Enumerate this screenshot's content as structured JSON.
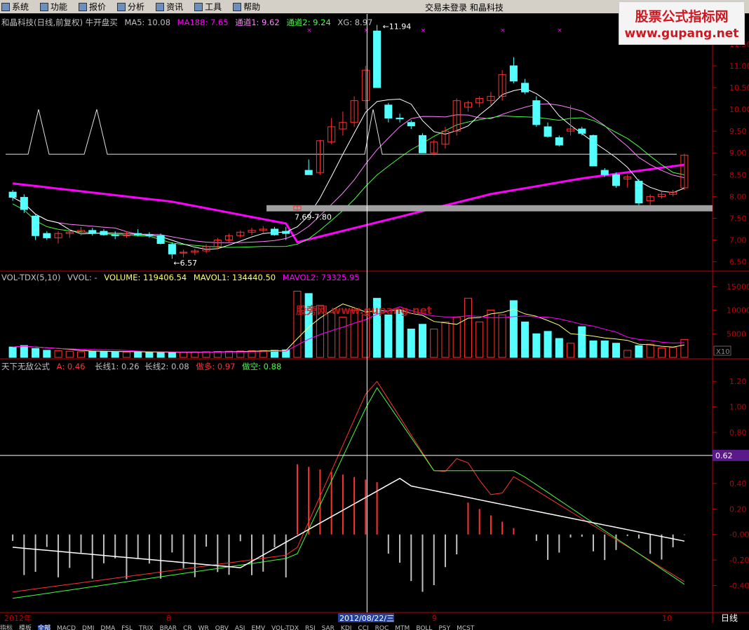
{
  "menu": {
    "items": [
      {
        "label": "系统",
        "icon": "system-icon"
      },
      {
        "label": "功能",
        "icon": "function-icon"
      },
      {
        "label": "报价",
        "icon": "quote-icon"
      },
      {
        "label": "分析",
        "icon": "analysis-icon"
      },
      {
        "label": "资讯",
        "icon": "news-icon"
      },
      {
        "label": "工具",
        "icon": "tools-icon"
      },
      {
        "label": "帮助",
        "icon": "help-icon"
      }
    ],
    "center_text": "交易未登录  和晶科技"
  },
  "watermark": {
    "line1": "股票公式指标网",
    "line2": "www.gupang.net",
    "center": "股旁网 www.gupang.net"
  },
  "colors": {
    "up": "#ff3232",
    "down": "#54ffff",
    "ma5": "#ffffff",
    "ma188": "#ff00ff",
    "ch1": "#ff80ff",
    "ch2": "#40ff40",
    "axis": "#c00000",
    "cross": "#ffffff",
    "selected": "#5a1a8a"
  },
  "price_panel": {
    "title": "和晶科技(日线,前复权) 牛开盘买",
    "ma5": "MA5: 10.08",
    "ma188": "MA188: 7.65",
    "ch1": "通道1: 9.62",
    "ch2": "通道2: 9.24",
    "xg": "XG: 8.97",
    "y_ticks": [
      "11.50",
      "11.00",
      "10.50",
      "10.00",
      "9.50",
      "9.00",
      "8.50",
      "8.00",
      "7.50",
      "7.00",
      "6.50"
    ],
    "annotations": {
      "high": "11.94",
      "low": "6.57",
      "range": "7.69-7.80"
    }
  },
  "vol_panel": {
    "title": "VOL-TDX(5,10)",
    "vvol": "VVOL: -",
    "volume": "VOLUME: 119406.54",
    "mavol1": "MAVOL1: 134440.50",
    "mavol2": "MAVOL2: 73325.95",
    "y_ticks": [
      "15000",
      "10000",
      "5000"
    ],
    "unit": "X10"
  },
  "ind_panel": {
    "title": "天下无敌公式",
    "a": "A: 0.46",
    "long1": "长线1: 0.26",
    "long2": "长线2: 0.08",
    "bull": "做多: 0.97",
    "bear": "做空: 0.88",
    "y_ticks": [
      "1.20",
      "1.00",
      "0.80",
      "0.60",
      "0.40",
      "0.20",
      "-0.00",
      "-0.20",
      "-0.40"
    ],
    "crosshair_value": "0.62"
  },
  "x_axis": {
    "labels": [
      "2012年",
      "8",
      "2012/08/22/三",
      "9",
      "10"
    ],
    "period": "日线"
  },
  "bottom_tabs": [
    "指标",
    "模板",
    "全部",
    "MACD",
    "DMI",
    "DMA",
    "FSL",
    "TRIX",
    "BRAR",
    "CR",
    "WR",
    "OBV",
    "ASI",
    "EMV",
    "VOL-TDX",
    "RSI",
    "SAR",
    "KDJ",
    "CCI",
    "ROC",
    "MTM",
    "BOLL",
    "PSY",
    "MCST"
  ],
  "chart_data": {
    "type": "candlestick",
    "candles": [
      [
        8.1,
        8.15,
        7.9,
        7.98
      ],
      [
        7.98,
        8.05,
        7.62,
        7.7
      ],
      [
        7.55,
        7.58,
        7.0,
        7.1
      ],
      [
        7.15,
        7.2,
        7.0,
        7.05
      ],
      [
        7.05,
        7.2,
        6.92,
        7.15
      ],
      [
        7.15,
        7.25,
        7.05,
        7.18
      ],
      [
        7.18,
        7.3,
        7.1,
        7.22
      ],
      [
        7.22,
        7.28,
        7.1,
        7.15
      ],
      [
        7.2,
        7.25,
        7.1,
        7.12
      ],
      [
        7.12,
        7.2,
        7.02,
        7.1
      ],
      [
        7.1,
        7.2,
        7.05,
        7.15
      ],
      [
        7.15,
        7.25,
        7.08,
        7.12
      ],
      [
        7.12,
        7.18,
        7.05,
        7.1
      ],
      [
        7.1,
        7.15,
        6.9,
        6.92
      ],
      [
        6.9,
        6.95,
        6.57,
        6.68
      ],
      [
        6.7,
        6.78,
        6.6,
        6.72
      ],
      [
        6.72,
        6.8,
        6.65,
        6.75
      ],
      [
        6.75,
        6.9,
        6.7,
        6.85
      ],
      [
        6.85,
        7.05,
        6.8,
        7.0
      ],
      [
        7.0,
        7.15,
        6.95,
        7.1
      ],
      [
        7.1,
        7.22,
        7.05,
        7.18
      ],
      [
        7.18,
        7.28,
        7.12,
        7.22
      ],
      [
        7.22,
        7.32,
        7.15,
        7.25
      ],
      [
        7.25,
        7.3,
        7.1,
        7.12
      ],
      [
        7.2,
        7.3,
        7.0,
        7.15
      ],
      [
        7.69,
        7.8,
        7.65,
        7.78
      ],
      [
        8.6,
        8.85,
        8.5,
        8.5
      ],
      [
        8.55,
        9.3,
        8.5,
        9.28
      ],
      [
        9.25,
        9.8,
        9.2,
        9.6
      ],
      [
        9.55,
        9.95,
        9.4,
        9.7
      ],
      [
        9.7,
        10.3,
        9.6,
        10.2
      ],
      [
        10.2,
        11.0,
        10.0,
        10.9
      ],
      [
        11.8,
        11.94,
        11.5,
        10.5
      ],
      [
        10.1,
        10.15,
        9.7,
        9.8
      ],
      [
        9.8,
        9.9,
        9.7,
        9.78
      ],
      [
        9.7,
        9.75,
        9.55,
        9.62
      ],
      [
        9.4,
        9.45,
        9.0,
        9.0
      ],
      [
        9.0,
        9.3,
        8.95,
        9.25
      ],
      [
        9.2,
        9.6,
        9.1,
        9.5
      ],
      [
        9.5,
        10.25,
        9.4,
        10.2
      ],
      [
        10.05,
        10.2,
        9.95,
        10.15
      ],
      [
        10.15,
        10.3,
        10.05,
        10.25
      ],
      [
        10.2,
        10.4,
        10.1,
        10.3
      ],
      [
        10.3,
        10.9,
        10.2,
        10.8
      ],
      [
        11.0,
        11.2,
        10.6,
        10.65
      ],
      [
        10.6,
        10.7,
        10.35,
        10.4
      ],
      [
        10.2,
        10.3,
        9.6,
        9.65
      ],
      [
        9.6,
        9.7,
        9.35,
        9.38
      ],
      [
        9.35,
        9.4,
        9.15,
        9.18
      ],
      [
        9.5,
        10.1,
        9.4,
        9.55
      ],
      [
        9.55,
        9.6,
        9.4,
        9.45
      ],
      [
        9.4,
        9.42,
        8.7,
        8.7
      ],
      [
        8.6,
        8.65,
        8.45,
        8.5
      ],
      [
        8.5,
        8.55,
        8.2,
        8.25
      ],
      [
        8.4,
        8.5,
        8.2,
        8.45
      ],
      [
        8.35,
        8.4,
        7.8,
        7.85
      ],
      [
        7.9,
        8.05,
        7.8,
        8.0
      ],
      [
        8.0,
        8.1,
        7.95,
        8.05
      ],
      [
        8.05,
        8.15,
        8.0,
        8.1
      ],
      [
        8.2,
        8.98,
        8.15,
        8.95
      ]
    ],
    "volumes": [
      2200,
      2500,
      1900,
      1500,
      1400,
      1300,
      1200,
      1300,
      1250,
      1200,
      1150,
      1100,
      1100,
      1050,
      1000,
      1100,
      1150,
      1200,
      1250,
      1300,
      1350,
      1400,
      1450,
      1500,
      1600,
      14000,
      13500,
      11000,
      9500,
      8500,
      10000,
      9000,
      12500,
      9000,
      10000,
      6000,
      7000,
      6000,
      7500,
      8500,
      12500,
      7500,
      10000,
      9000,
      12000,
      7500,
      5000,
      5500,
      4000,
      3000,
      6500,
      3500,
      3500,
      3000,
      1500,
      2500,
      2800,
      2000,
      2100,
      3800
    ],
    "ylim_price": [
      6.3,
      11.9
    ],
    "ylim_volume": [
      0,
      16000
    ],
    "ylim_indicator": [
      -0.6,
      1.3
    ]
  }
}
